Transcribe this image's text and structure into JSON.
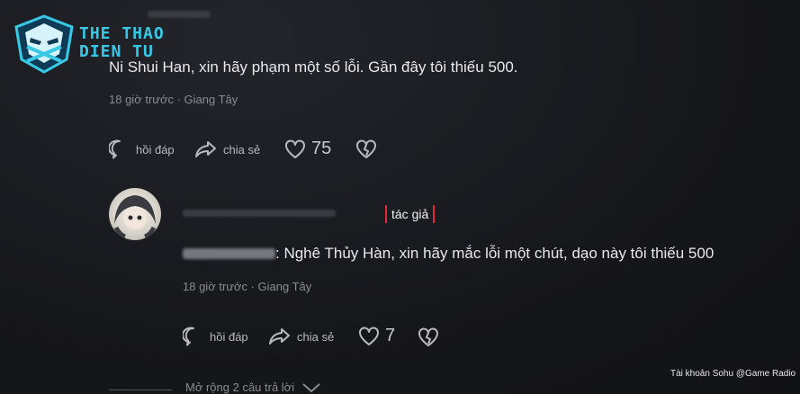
{
  "logo": {
    "line1": "THE THAO",
    "line2": "DIEN TU"
  },
  "comment1": {
    "text": "Ni Shui Han, xin hãy phạm một số lỗi. Gần đây tôi thiếu 500.",
    "meta": "18 giờ trước · Giang Tây",
    "reply_label": "hồi đáp",
    "share_label": "chia sẻ",
    "like_count": "75"
  },
  "reply": {
    "author_tag": "tác giả",
    "text": ": Nghê Thủy Hàn, xin hãy mắc lỗi một chút, dạo này tôi thiếu 500",
    "meta": "18 giờ trước · Giang Tây",
    "reply_label": "hồi đáp",
    "share_label": "chia sẻ",
    "like_count": "7"
  },
  "expand_label": "Mở rộng 2 câu trả lời",
  "credit": "Tài khoản Sohu @Game Radio",
  "icons": [
    "reply-icon",
    "share-icon",
    "heart-icon",
    "dislike-icon",
    "chevron-down-icon"
  ],
  "colors": {
    "accent_logo": "#37c9e6",
    "author_tag_border": "#e0283d",
    "background": "#16171b"
  }
}
